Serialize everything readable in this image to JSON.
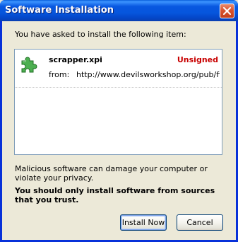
{
  "window": {
    "title": "Software Installation"
  },
  "dialog": {
    "intro": "You have asked to install the following item:",
    "items": [
      {
        "name": "scrapper.xpi",
        "status": "Unsigned",
        "from_label": "from:",
        "url": "http://www.devilsworkshop.org/pub/firefox/scrapper.xpi",
        "icon": "puzzle-piece-icon"
      }
    ],
    "warning": "Malicious software can damage your computer or violate your privacy.",
    "advice": "You should only install software from sources that you trust."
  },
  "buttons": {
    "install_label": "Install Now",
    "cancel_label": "Cancel"
  },
  "colors": {
    "title_bar": "#0a5fdc",
    "dialog_bg": "#ece9d8",
    "unsigned": "#c80000",
    "close_button": "#d9532e"
  }
}
